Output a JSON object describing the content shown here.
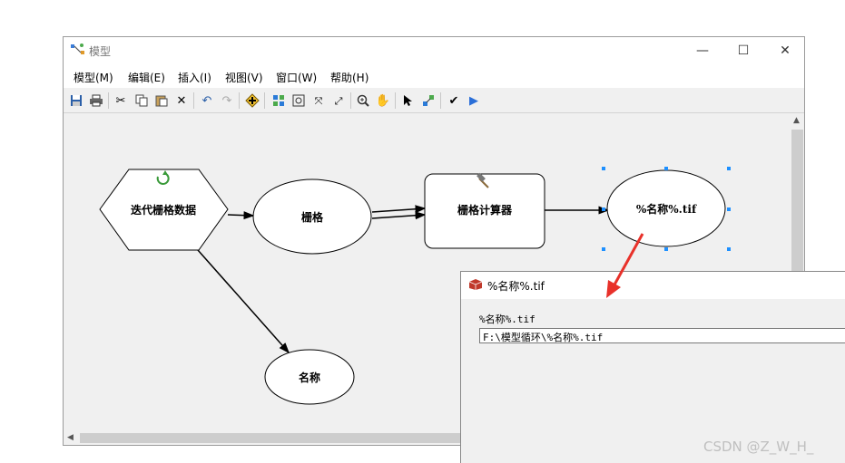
{
  "window": {
    "title": "模型",
    "controls": {
      "minimize": "—",
      "maximize": "☐",
      "close": "✕"
    }
  },
  "menu": [
    "模型(M)",
    "编辑(E)",
    "插入(I)",
    "视图(V)",
    "窗口(W)",
    "帮助(H)"
  ],
  "toolbar_icons": [
    "save-icon",
    "print-icon",
    "cut-icon",
    "copy-icon",
    "paste-icon",
    "delete-icon",
    "undo-icon",
    "redo-icon",
    "add-data-icon",
    "auto-layout-icon",
    "full-extent-icon",
    "fit-icon",
    "zoom-fit-icon",
    "zoom-in-icon",
    "pan-icon",
    "select-icon",
    "connect-icon",
    "validate-icon",
    "run-icon"
  ],
  "diagram": {
    "iterator": "迭代栅格数据",
    "raster": "栅格",
    "tool": "栅格计算器",
    "output": "%名称%.tif",
    "name_var": "名称"
  },
  "popup": {
    "title": "%名称%.tif",
    "label": "%名称%.tif",
    "value": "F:\\模型循环\\%名称%.tif"
  },
  "watermark": "CSDN @Z_W_H_",
  "colors": {
    "selection": "#1e90ff",
    "annotation_arrow": "#e8312a",
    "iterator_icon": "#3a9a3a"
  }
}
